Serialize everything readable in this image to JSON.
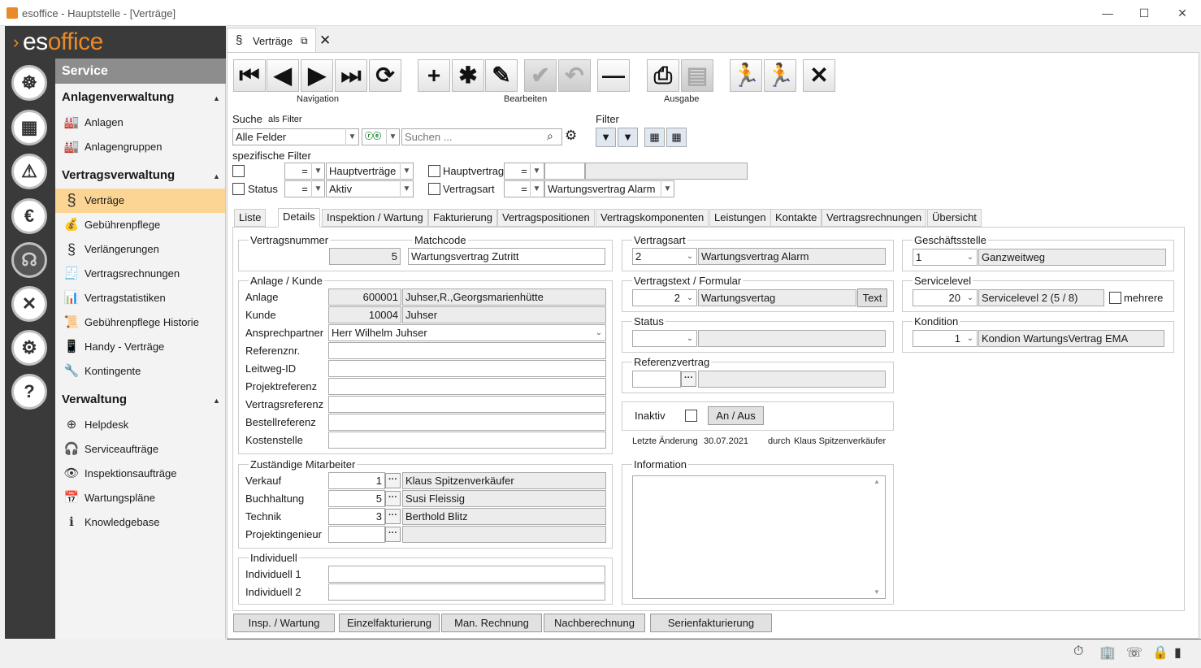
{
  "window": {
    "title": "esoffice - Hauptstelle - [Verträge]"
  },
  "logo": {
    "text_pre": "es",
    "text_post": "office"
  },
  "sidebar": {
    "header": "Service",
    "groups": [
      {
        "title": "Anlagenverwaltung",
        "items": [
          {
            "label": "Anlagen",
            "icon": "factory-icon"
          },
          {
            "label": "Anlagengruppen",
            "icon": "factory-group-icon"
          }
        ]
      },
      {
        "title": "Vertragsverwaltung",
        "items": [
          {
            "label": "Verträge",
            "icon": "paragraph-icon",
            "active": true
          },
          {
            "label": "Gebührenpflege",
            "icon": "money-bag-icon"
          },
          {
            "label": "Verlängerungen",
            "icon": "renew-icon"
          },
          {
            "label": "Vertragsrechnungen",
            "icon": "invoice-icon"
          },
          {
            "label": "Vertragstatistiken",
            "icon": "statistics-icon"
          },
          {
            "label": "Gebührenpflege Historie",
            "icon": "history-icon"
          },
          {
            "label": "Handy - Verträge",
            "icon": "mobile-phone-icon"
          },
          {
            "label": "Kontingente",
            "icon": "tools-icon"
          }
        ]
      },
      {
        "title": "Verwaltung",
        "items": [
          {
            "label": "Helpdesk",
            "icon": "lifebuoy-icon"
          },
          {
            "label": "Serviceaufträge",
            "icon": "headset-icon"
          },
          {
            "label": "Inspektionsaufträge",
            "icon": "eye-icon"
          },
          {
            "label": "Wartungspläne",
            "icon": "calendar-icon"
          },
          {
            "label": "Knowledgebase",
            "icon": "info-icon"
          }
        ]
      }
    ]
  },
  "doc_tab": {
    "label": "Verträge"
  },
  "toolbar": {
    "navigation_label": "Navigation",
    "edit_label": "Bearbeiten",
    "output_label": "Ausgabe"
  },
  "search": {
    "label": "Suche",
    "as_filter": "als Filter",
    "field": "Alle Felder",
    "placeholder": "Suchen ...",
    "filter_label": "Filter"
  },
  "spec_filter": {
    "title": "spezifische Filter",
    "row1": {
      "label": "",
      "op": "=",
      "value": "Hauptverträge",
      "label2": "Hauptvertrag",
      "op2": "=",
      "value2": ""
    },
    "row2": {
      "label": "Status",
      "op": "=",
      "value": "Aktiv",
      "label2": "Vertragsart",
      "op2": "=",
      "value2": "Wartungsvertrag Alarm"
    }
  },
  "subtabs": [
    "Liste",
    "Details",
    "Inspektion / Wartung",
    "Fakturierung",
    "Vertragspositionen",
    "Vertragskomponenten",
    "Leistungen",
    "Kontakte",
    "Vertragsrechnungen",
    "Übersicht"
  ],
  "details": {
    "vertragsnummer": {
      "label": "Vertragsnummer",
      "value": "5"
    },
    "matchcode": {
      "label": "Matchcode",
      "value": "Wartungsvertrag Zutritt"
    },
    "anlage_kunde": {
      "title": "Anlage / Kunde",
      "anlage_label": "Anlage",
      "anlage_nr": "600001",
      "anlage_name": "Juhser,R.,Georgsmarienhütte",
      "kunde_label": "Kunde",
      "kunde_nr": "10004",
      "kunde_name": "Juhser",
      "ansprech_label": "Ansprechpartner",
      "ansprech_value": "Herr Wilhelm Juhser",
      "fields": [
        {
          "label": "Referenznr.",
          "value": ""
        },
        {
          "label": "Leitweg-ID",
          "value": ""
        },
        {
          "label": "Projektreferenz",
          "value": ""
        },
        {
          "label": "Vertragsreferenz",
          "value": ""
        },
        {
          "label": "Bestellreferenz",
          "value": ""
        },
        {
          "label": "Kostenstelle",
          "value": ""
        }
      ]
    },
    "mitarbeiter": {
      "title": "Zuständige Mitarbeiter",
      "rows": [
        {
          "label": "Verkauf",
          "nr": "1",
          "name": "Klaus Spitzenverkäufer"
        },
        {
          "label": "Buchhaltung",
          "nr": "5",
          "name": "Susi Fleissig"
        },
        {
          "label": "Technik",
          "nr": "3",
          "name": "Berthold Blitz"
        },
        {
          "label": "Projektingenieur",
          "nr": "",
          "name": ""
        }
      ]
    },
    "individuell": {
      "title": "Individuell",
      "fields": [
        {
          "label": "Individuell 1",
          "value": ""
        },
        {
          "label": "Individuell 2",
          "value": ""
        }
      ]
    },
    "vertragsart": {
      "title": "Vertragsart",
      "nr": "2",
      "name": "Wartungsvertrag Alarm"
    },
    "vertragstext": {
      "title": "Vertragstext / Formular",
      "nr": "2",
      "name": "Wartungsvertag",
      "button": "Text"
    },
    "status": {
      "title": "Status",
      "nr": "",
      "name": ""
    },
    "referenzvertrag": {
      "title": "Referenzvertrag",
      "nr": "",
      "name": ""
    },
    "inaktiv": {
      "label": "Inaktiv",
      "button": "An / Aus"
    },
    "last_change": {
      "label": "Letzte Änderung",
      "date": "30.07.2021",
      "by_label": "durch",
      "by": "Klaus Spitzenverkäufer"
    },
    "information": {
      "title": "Information",
      "value": ""
    },
    "geschaeftsstelle": {
      "title": "Geschäftsstelle",
      "nr": "1",
      "name": "Ganzweitweg"
    },
    "servicelevel": {
      "title": "Servicelevel",
      "nr": "20",
      "name": "Servicelevel 2 (5 / 8)",
      "mehrere": "mehrere"
    },
    "kondition": {
      "title": "Kondition",
      "nr": "1",
      "name": "Kondion WartungsVertrag EMA"
    }
  },
  "bottom_buttons": [
    "Insp. / Wartung",
    "Einzelfakturierung",
    "Man. Rechnung",
    "Nachberechnung",
    "Serienfakturierung"
  ]
}
